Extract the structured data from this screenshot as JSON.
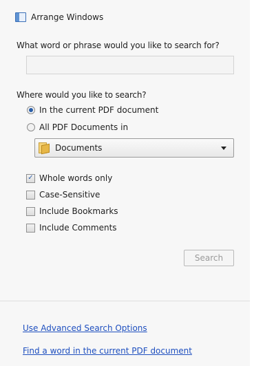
{
  "header": {
    "arrange_label": "Arrange Windows"
  },
  "search": {
    "question": "What word or phrase would you like to search for?",
    "value": "",
    "placeholder": ""
  },
  "location": {
    "question": "Where would you like to search?",
    "options": [
      {
        "label": "In the current PDF document",
        "selected": true
      },
      {
        "label": "All PDF Documents in",
        "selected": false
      }
    ],
    "folder_selected": "Documents"
  },
  "options": {
    "whole_words": {
      "label": "Whole words only",
      "checked": true
    },
    "case_sensitive": {
      "label": "Case-Sensitive",
      "checked": false
    },
    "bookmarks": {
      "label": "Include Bookmarks",
      "checked": false
    },
    "comments": {
      "label": "Include Comments",
      "checked": false
    }
  },
  "search_button": {
    "label": "Search",
    "enabled": false
  },
  "links": {
    "advanced": "Use Advanced Search Options",
    "find_word": "Find a word in the current PDF document"
  },
  "colors": {
    "panel_bg": "#f7f7f7",
    "link": "#1e4fbf",
    "accent": "#2a5ea8"
  },
  "icons": {
    "arrange": "arrange-windows-icon",
    "folder": "folder-icon",
    "dropdown": "chevron-down-icon"
  }
}
